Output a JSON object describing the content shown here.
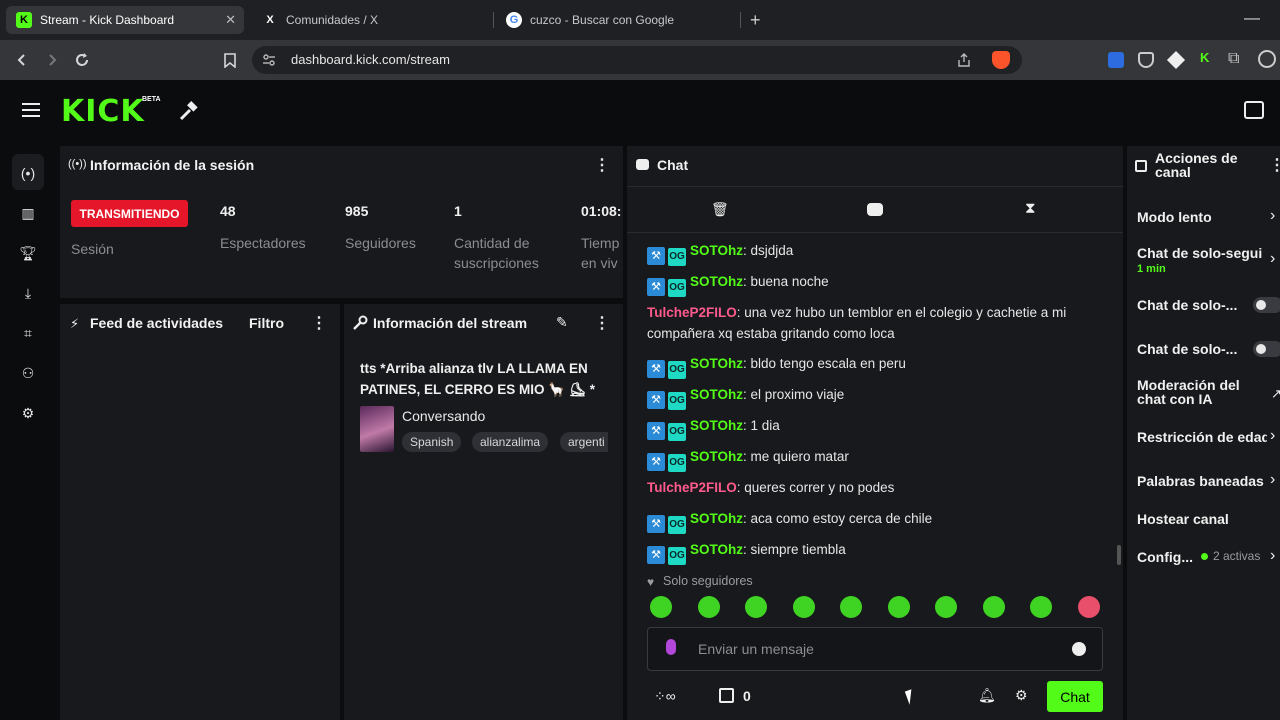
{
  "browser": {
    "tabs": [
      {
        "title": "Stream - Kick Dashboard",
        "favicon": "K"
      },
      {
        "title": "Comunidades / X",
        "favicon": "X"
      },
      {
        "title": "cuzco - Buscar con Google",
        "favicon": "G"
      }
    ],
    "new_tab": "+",
    "url": "dashboard.kick.com/stream"
  },
  "app": {
    "logo": "KICK",
    "logo_badge": "BETA"
  },
  "session": {
    "title": "Información de la sesión",
    "live_badge": "TRANSMITIENDO",
    "session_label": "Sesión",
    "stats": [
      {
        "value": "48",
        "label": "Espectadores"
      },
      {
        "value": "985",
        "label": "Seguidores"
      },
      {
        "value": "1",
        "label": "Cantidad de suscripciones"
      },
      {
        "value": "01:08:",
        "label": "Tiemp en viv"
      }
    ]
  },
  "feed": {
    "title": "Feed de actividades",
    "filter": "Filtro"
  },
  "stream_info": {
    "title": "Información del stream",
    "stream_title": "tts *Arriba alianza tlv LA LLAMA EN PATINES, EL CERRO ES MIO 🦙 ⛸ *",
    "category": "Conversando",
    "tags": [
      "Spanish",
      "alianzalima",
      "argenti"
    ]
  },
  "chat": {
    "title": "Chat",
    "messages": [
      {
        "user": "SOTOhz",
        "color": "green",
        "badges": true,
        "text": "dsjdjda"
      },
      {
        "user": "SOTOhz",
        "color": "green",
        "badges": true,
        "text": "buena noche"
      },
      {
        "user": "TulcheP2FILO",
        "color": "pink",
        "badges": false,
        "text": "una vez hubo un temblor en el colegio y cachetie a mi compañera xq estaba gritando como loca"
      },
      {
        "user": "SOTOhz",
        "color": "green",
        "badges": true,
        "text": "bldo tengo escala en peru"
      },
      {
        "user": "SOTOhz",
        "color": "green",
        "badges": true,
        "text": "el proximo viaje"
      },
      {
        "user": "SOTOhz",
        "color": "green",
        "badges": true,
        "text": "1 dia"
      },
      {
        "user": "SOTOhz",
        "color": "green",
        "badges": true,
        "text": "me quiero matar"
      },
      {
        "user": "TulcheP2FILO",
        "color": "pink",
        "badges": false,
        "text": "queres correr y no podes"
      },
      {
        "user": "SOTOhz",
        "color": "green",
        "badges": true,
        "text": "aca como estoy cerca de chile"
      },
      {
        "user": "SOTOhz",
        "color": "green",
        "badges": true,
        "text": "siempre tiembla"
      }
    ],
    "followers_only": "Solo seguidores",
    "input_placeholder": "Enviar un mensaje",
    "points": "0",
    "send_label": "Chat"
  },
  "actions": {
    "title": "Acciones de canal",
    "items": [
      {
        "label": "Modo lento"
      },
      {
        "label": "Chat de solo-segui",
        "sub": "1 min"
      },
      {
        "label": "Chat de solo-..."
      },
      {
        "label": "Chat de solo-..."
      },
      {
        "label": "Moderación del chat con IA"
      },
      {
        "label": "Restricción de edad"
      },
      {
        "label": "Palabras baneadas"
      },
      {
        "label": "Hostear canal"
      },
      {
        "label": "Config...",
        "sub": "2 activas"
      }
    ]
  },
  "colors": {
    "accent": "#53fc18",
    "live": "#e5162a",
    "username_green": "#53fc18",
    "username_pink": "#ff5a8c"
  }
}
